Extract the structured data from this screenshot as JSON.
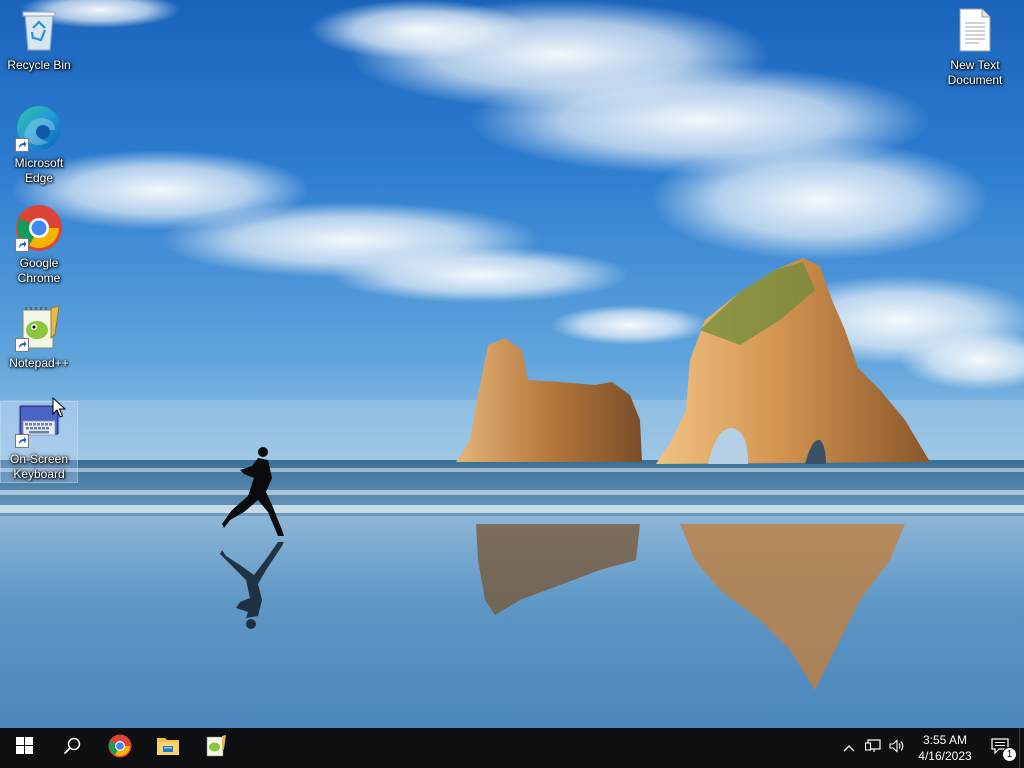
{
  "desktop": {
    "icons": [
      {
        "id": "recycle-bin",
        "label": "Recycle Bin",
        "icon": "recycle-bin-icon",
        "shortcut": false
      },
      {
        "id": "edge",
        "label": "Microsoft\nEdge",
        "icon": "edge-icon",
        "shortcut": true
      },
      {
        "id": "chrome",
        "label": "Google\nChrome",
        "icon": "chrome-icon",
        "shortcut": true
      },
      {
        "id": "notepadpp",
        "label": "Notepad++",
        "icon": "notepadpp-icon",
        "shortcut": true
      },
      {
        "id": "osk",
        "label": "On-Screen\nKeyboard",
        "icon": "keyboard-icon",
        "shortcut": true,
        "selected": true
      },
      {
        "id": "new-text",
        "label": "New Text\nDocument",
        "icon": "text-document-icon",
        "shortcut": false
      }
    ]
  },
  "taskbar": {
    "start": "windows-logo-icon",
    "search": "search-icon",
    "pinned": [
      {
        "id": "chrome",
        "icon": "chrome-icon"
      },
      {
        "id": "explorer",
        "icon": "file-explorer-icon"
      },
      {
        "id": "notepadpp",
        "icon": "notepadpp-icon"
      }
    ],
    "tray": {
      "chevron": "chevron-up-icon",
      "network": "network-icon",
      "volume": "volume-icon"
    },
    "clock": {
      "time": "3:55 AM",
      "date": "4/16/2023"
    },
    "notifications": {
      "icon": "action-center-icon",
      "count": "1"
    }
  },
  "colors": {
    "taskbar": "#0d0f12",
    "sky_top": "#1c6ac0",
    "sky_mid": "#3f8fd6",
    "sea": "#5c95bf",
    "sand": "#6a9cc4",
    "rock": "#c98a48"
  }
}
